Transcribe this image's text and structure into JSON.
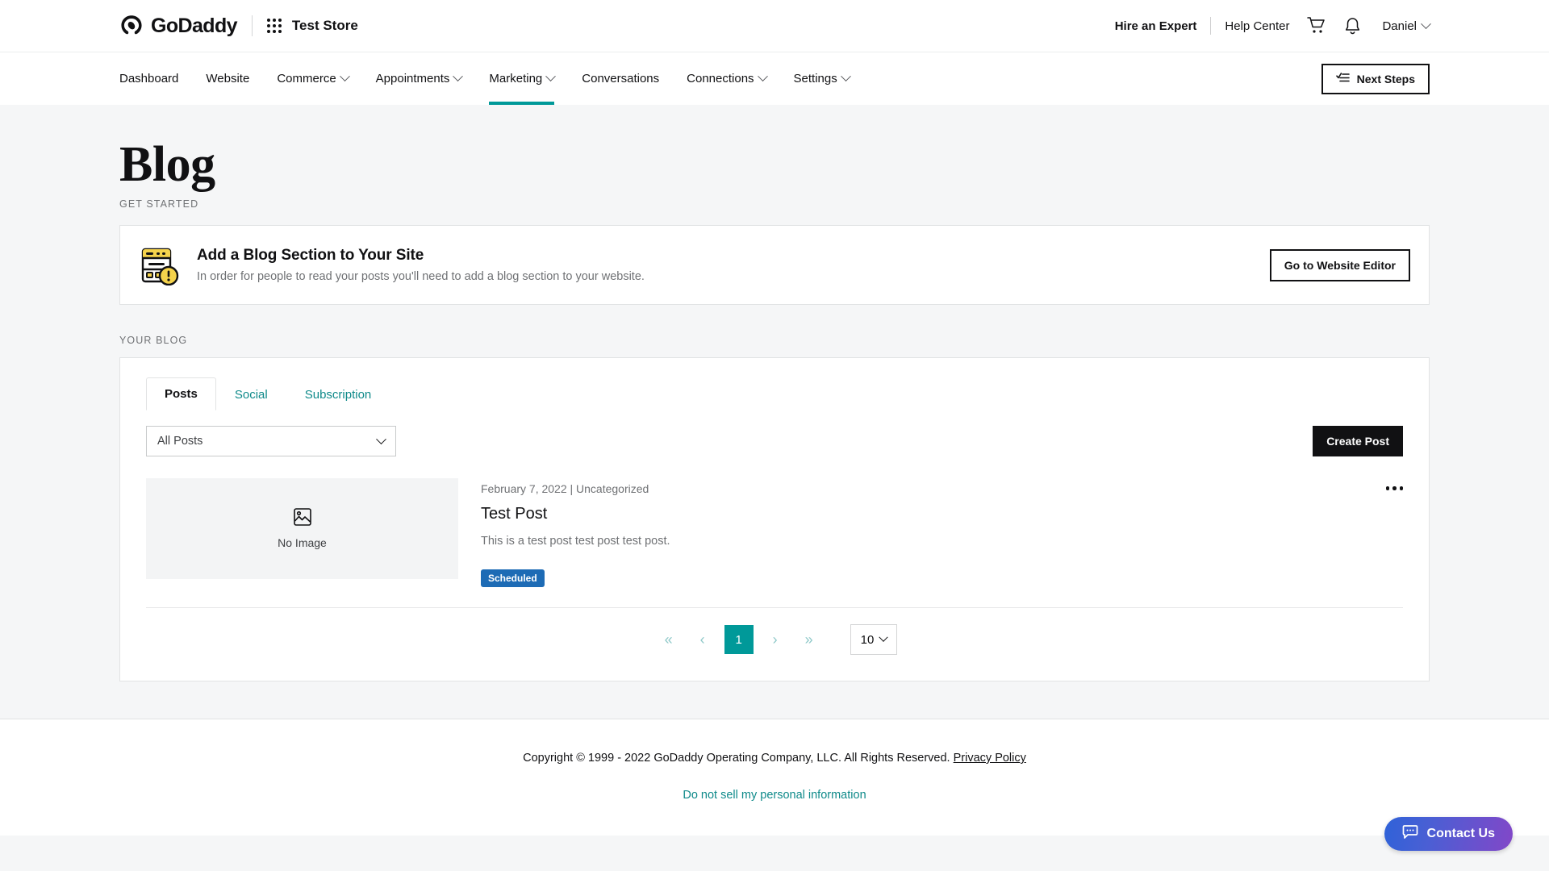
{
  "topbar": {
    "brand_name": "GoDaddy",
    "store_name": "Test Store",
    "hire_expert": "Hire an Expert",
    "help_center": "Help Center",
    "cart_icon": "shopping-cart-icon",
    "bell_icon": "notification-bell-icon",
    "grid_icon": "app-grid-icon",
    "user_name": "Daniel"
  },
  "nav": {
    "items": [
      {
        "label": "Dashboard",
        "has_chevron": false,
        "active": false
      },
      {
        "label": "Website",
        "has_chevron": false,
        "active": false
      },
      {
        "label": "Commerce",
        "has_chevron": true,
        "active": false
      },
      {
        "label": "Appointments",
        "has_chevron": true,
        "active": false
      },
      {
        "label": "Marketing",
        "has_chevron": true,
        "active": true
      },
      {
        "label": "Conversations",
        "has_chevron": false,
        "active": false
      },
      {
        "label": "Connections",
        "has_chevron": true,
        "active": false
      },
      {
        "label": "Settings",
        "has_chevron": true,
        "active": false
      }
    ],
    "next_steps_label": "Next Steps",
    "active_underline_color": "#009999"
  },
  "page": {
    "title": "Blog",
    "get_started_label": "GET STARTED",
    "your_blog_label": "YOUR BLOG"
  },
  "alert": {
    "icon": "website-warning-icon",
    "title": "Add a Blog Section to Your Site",
    "description": "In order for people to read your posts you'll need to add a blog section to your website.",
    "button_label": "Go to Website Editor"
  },
  "panel": {
    "tabs": [
      {
        "label": "Posts",
        "active": true
      },
      {
        "label": "Social",
        "active": false
      },
      {
        "label": "Subscription",
        "active": false
      }
    ],
    "filter": {
      "value": "All Posts",
      "icon": "chevron-down-icon"
    },
    "create_post_label": "Create Post"
  },
  "posts": [
    {
      "thumbnail_placeholder": "No Image",
      "thumbnail_icon": "image-placeholder-icon",
      "date": "February 7, 2022",
      "separator": "|",
      "category": "Uncategorized",
      "meta": "February 7, 2022 | Uncategorized",
      "title": "Test Post",
      "excerpt": "This is a test post test post test post.",
      "status": "Scheduled",
      "status_color": "#1d6bb5",
      "menu_icon": "more-options-icon"
    }
  ],
  "pagination": {
    "first_label": "«",
    "prev_label": "‹",
    "current_page": "1",
    "next_label": "›",
    "last_label": "»",
    "page_size": "10",
    "active_color": "#009999"
  },
  "footer": {
    "copyright": "Copyright © 1999 - 2022 GoDaddy Operating Company, LLC. All Rights Reserved.",
    "privacy_policy": "Privacy Policy",
    "do_not_sell": "Do not sell my personal information"
  },
  "contact": {
    "label": "Contact Us",
    "icon": "chat-bubble-icon"
  }
}
